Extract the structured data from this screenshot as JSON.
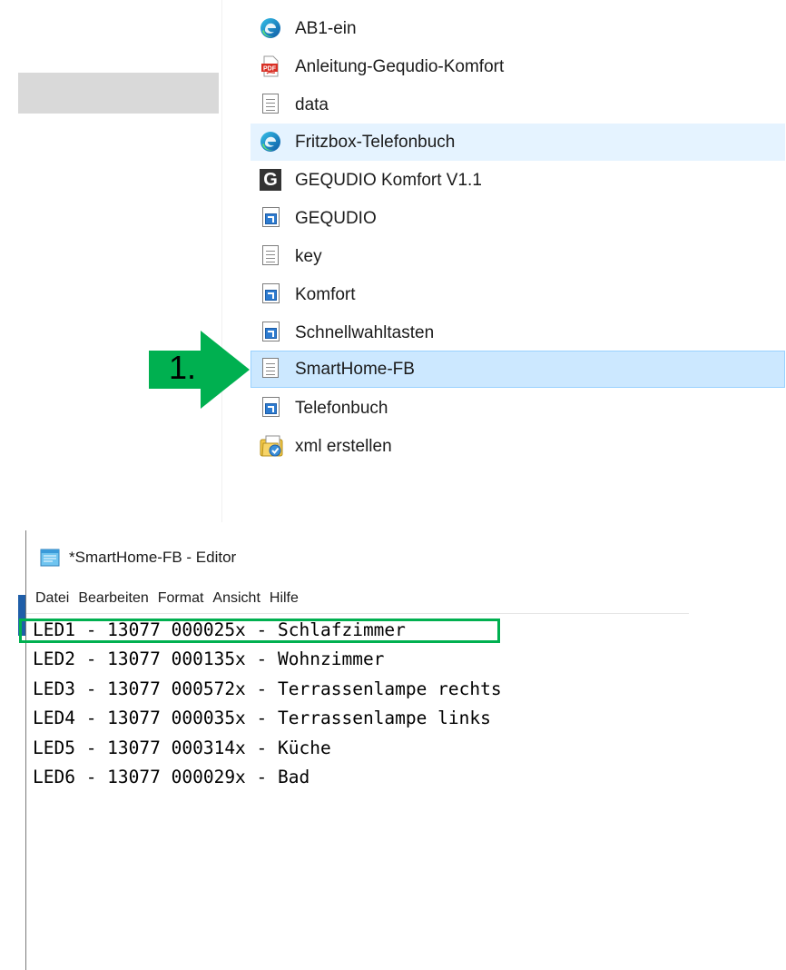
{
  "explorer": {
    "files": [
      {
        "name": "AB1-ein",
        "icon": "edge-icon",
        "state": "normal"
      },
      {
        "name": "Anleitung-Gequdio-Komfort",
        "icon": "pdf-icon",
        "state": "normal"
      },
      {
        "name": "data",
        "icon": "text-file-icon",
        "state": "normal"
      },
      {
        "name": "Fritzbox-Telefonbuch",
        "icon": "edge-icon",
        "state": "hover"
      },
      {
        "name": "GEQUDIO Komfort V1.1",
        "icon": "gequdio-app-icon",
        "state": "normal"
      },
      {
        "name": "GEQUDIO",
        "icon": "shortcut-icon",
        "state": "normal"
      },
      {
        "name": "key",
        "icon": "text-file-icon",
        "state": "normal"
      },
      {
        "name": "Komfort",
        "icon": "shortcut-icon",
        "state": "normal"
      },
      {
        "name": "Schnellwahltasten",
        "icon": "shortcut-icon",
        "state": "normal"
      },
      {
        "name": "SmartHome-FB",
        "icon": "text-file-icon",
        "state": "selected"
      },
      {
        "name": "Telefonbuch",
        "icon": "shortcut-icon",
        "state": "normal"
      },
      {
        "name": "xml erstellen",
        "icon": "batch-file-icon",
        "state": "normal"
      }
    ]
  },
  "annotation": {
    "step_label": "1.",
    "color": "#00b050"
  },
  "notepad": {
    "title": "*SmartHome-FB - Editor",
    "menu": [
      "Datei",
      "Bearbeiten",
      "Format",
      "Ansicht",
      "Hilfe"
    ],
    "lines": [
      "LED1 - 13077 000025x - Schlafzimmer",
      "LED2 - 13077 000135x - Wohnzimmer",
      "LED3 - 13077 000572x - Terrassenlampe rechts",
      "LED4 - 13077 000035x - Terrassenlampe links",
      "LED5 - 13077 000314x - Küche",
      "LED6 - 13077 000029x - Bad"
    ],
    "highlighted_line": 0
  },
  "colors": {
    "hover_bg": "#e5f3ff",
    "selected_bg": "#cce8ff",
    "selected_border": "#99d1ff",
    "annotation_green": "#00b050"
  }
}
